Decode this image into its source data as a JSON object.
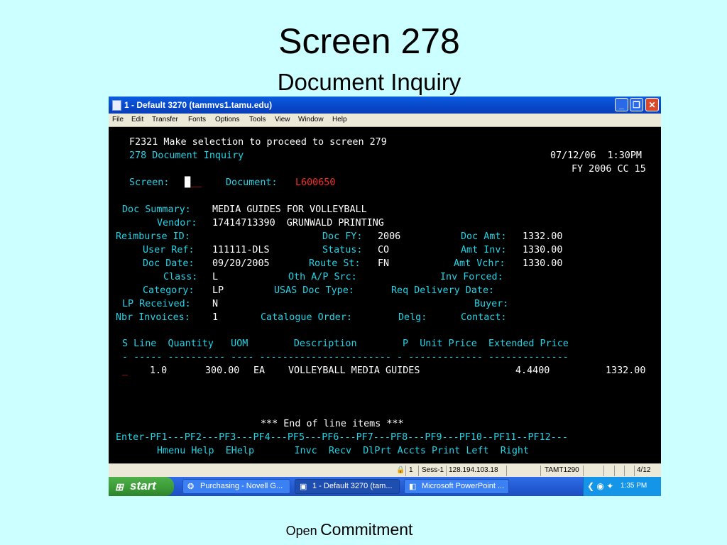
{
  "slide": {
    "title": "Screen 278",
    "subtitle": "Document Inquiry",
    "caption_1": "Open",
    "caption_2": "Commitment"
  },
  "window": {
    "title": "1 - Default 3270 (tammvs1.tamu.edu)",
    "menu": [
      "File",
      "Edit",
      "Transfer",
      "Fonts",
      "Options",
      "Tools",
      "View",
      "Window",
      "Help"
    ],
    "controls": {
      "minimize": "_",
      "restore": "❐",
      "close": "✕"
    }
  },
  "colors": {
    "label": "#22d3e6",
    "value": "#ffffff",
    "error": "#ff2a2a",
    "background": "#000000",
    "slide_bg": "#ccffff"
  },
  "terminal": {
    "message": "F2321 Make selection to proceed to screen 279",
    "screen_title": "278 Document Inquiry",
    "date_time": "07/12/06  1:30PM",
    "fy_line": "FY 2006 CC 15",
    "screen_label": "Screen:",
    "screen_cursor": "█",
    "screen_underscore": "__",
    "document_label": "Document:",
    "document_value": "L600650",
    "doc_summary_label": "Doc Summary:",
    "doc_summary_value": "MEDIA GUIDES FOR VOLLEYBALL",
    "vendor_label": "Vendor:",
    "vendor_value": "17414713390  GRUNWALD PRINTING",
    "reimburse_label": "Reimburse ID:",
    "doc_fy_label": "Doc FY:",
    "doc_fy_value": "2006",
    "doc_amt_label": "Doc Amt:",
    "doc_amt_value": "1332.00",
    "user_ref_label": "User Ref:",
    "user_ref_value": "111111-DLS",
    "status_label": "Status:",
    "status_value": "CO",
    "amt_inv_label": "Amt Inv:",
    "amt_inv_value": "1330.00",
    "doc_date_label": "Doc Date:",
    "doc_date_value": "09/20/2005",
    "route_st_label": "Route St:",
    "route_st_value": "FN",
    "amt_vchr_label": "Amt Vchr:",
    "amt_vchr_value": "1330.00",
    "class_label": "Class:",
    "class_value": "L",
    "oth_ap_label": "Oth A/P Src:",
    "inv_forced_label": "Inv Forced:",
    "category_label": "Category:",
    "category_value": "LP",
    "usas_label": "USAS Doc Type:",
    "req_delivery_label": "Req Delivery Date:",
    "lp_received_label": "LP Received:",
    "lp_received_value": "N",
    "buyer_label": "Buyer:",
    "nbr_invoices_label": "Nbr Invoices:",
    "nbr_invoices_value": "1",
    "catalogue_label": "Catalogue Order:",
    "delg_label": "Delg:",
    "contact_label": "Contact:",
    "table_header": "S Line  Quantity   UOM        Description        P  Unit Price  Extended Price",
    "table_rule": "- ----- ---------- ---- ----------------------- - ------------- --------------",
    "row": {
      "select": "_",
      "line": "1.0",
      "quantity": "300.00",
      "uom": "EA",
      "description": "VOLLEYBALL MEDIA GUIDES",
      "unit_price": "4.4400",
      "extended_price": "1332.00"
    },
    "end_line": "*** End of line items ***",
    "pf_keys": "Enter-PF1---PF2---PF3---PF4---PF5---PF6---PF7---PF8---PF9---PF10--PF11--PF12---",
    "pf_labels": "Hmenu Help  EHelp       Invc  Recv  DlPrt Accts Print Left  Right"
  },
  "status_bar": {
    "cell1": "1",
    "session": "Sess-1",
    "ip": "128.194.103.18",
    "terminal": "TAMT1290",
    "position": "4/12"
  },
  "taskbar": {
    "start": "start",
    "tasks": [
      "Purchasing - Novell G...",
      "1 - Default 3270 (tam...",
      "Microsoft PowerPoint ..."
    ],
    "clock": "1:35 PM"
  }
}
